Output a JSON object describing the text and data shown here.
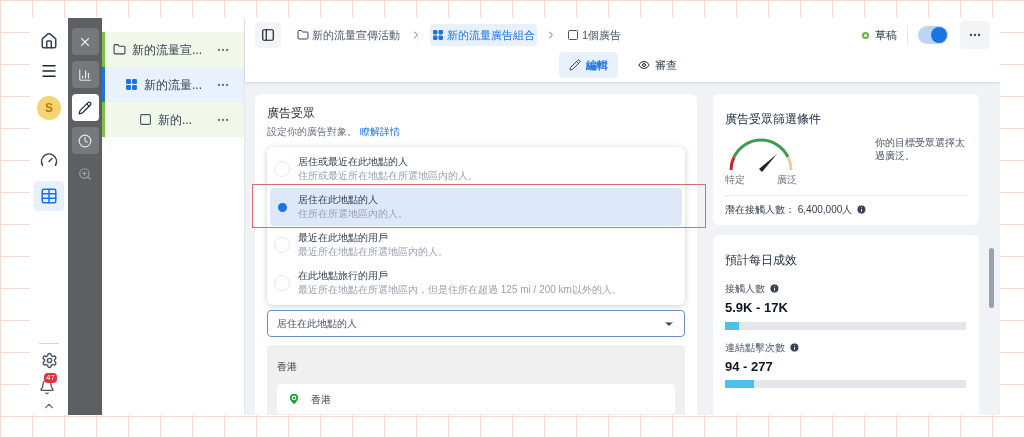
{
  "nav": {
    "avatar": "S",
    "notification_count": "47"
  },
  "tool_strip": [
    {
      "kind": "close",
      "selected": false
    },
    {
      "kind": "chart",
      "selected": false
    },
    {
      "kind": "edit",
      "selected": true
    },
    {
      "kind": "history",
      "selected": false
    },
    {
      "kind": "zoom",
      "selected": false
    }
  ],
  "tree": [
    {
      "label": "新的流量宣...",
      "kind": "campaign",
      "selected": false
    },
    {
      "label": "新的流量...",
      "kind": "adset",
      "selected": true
    },
    {
      "label": "新的...",
      "kind": "ad",
      "selected": false
    }
  ],
  "breadcrumb": [
    {
      "label": "新的流量宣傳活動",
      "kind": "campaign",
      "selected": false
    },
    {
      "label": "新的流量廣告組合",
      "kind": "adset",
      "selected": true
    },
    {
      "label": "1個廣告",
      "kind": "ad",
      "selected": false
    }
  ],
  "status": {
    "label": "草稿"
  },
  "toggle": {
    "on": true
  },
  "view_tabs": [
    {
      "label": "編輯",
      "kind": "edit",
      "selected": true
    },
    {
      "label": "審查",
      "kind": "review",
      "selected": false
    }
  ],
  "audience": {
    "title": "廣告受眾",
    "subtitle": "設定你的廣告對象。",
    "link": "瞭解詳情",
    "options": [
      {
        "title": "居住或最近在此地點的人",
        "description": "住所或最近所在地點在所選地區內的人。",
        "selected": false
      },
      {
        "title": "居住在此地點的人",
        "description": "住所在所選地區內的人。",
        "selected": true
      },
      {
        "title": "最近在此地點的用戶",
        "description": "最近所在地點在所選地區內的人。",
        "selected": false
      },
      {
        "title": "在此地點旅行的用戶",
        "description": "最近所在地點在所選地區內，但是住所在超過 125 mi / 200 km以外的人。",
        "selected": false
      }
    ],
    "select": {
      "value": "居住在此地點的人"
    },
    "locations": {
      "region": "香港",
      "items": [
        {
          "label": "香港"
        }
      ]
    }
  },
  "definition": {
    "title": "廣告受眾篩選條件",
    "gauge_min": "特定",
    "gauge_max": "廣泛",
    "message": "你的目標受眾選擇太過廣泛。",
    "potential_reach": "潛在接觸人數： 6,400,000人"
  },
  "estimates": {
    "title": "預計每日成效",
    "metrics": [
      {
        "label": "接觸人數",
        "value": "5.9K - 17K",
        "level": 0.06
      },
      {
        "label": "連結點擊次數",
        "value": "94 - 277",
        "level": 0.12
      }
    ]
  }
}
